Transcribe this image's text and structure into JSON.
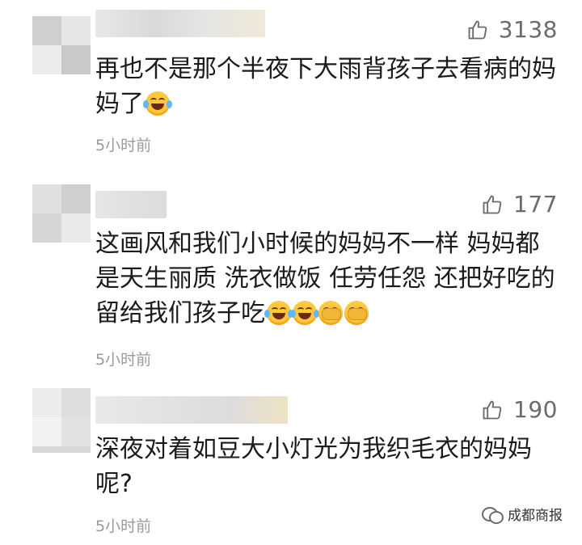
{
  "comments": [
    {
      "likes": "3138",
      "text": "再也不是那个半夜下大雨背孩子去看病的妈妈了",
      "emojis": [
        "laugh-cry-emoji"
      ],
      "time": "5小时前"
    },
    {
      "likes": "177",
      "text": "这画风和我们小时候的妈妈不一样 妈妈都是天生丽质 洗衣做饭 任劳任怨 还把好吃的留给我们孩子吃",
      "emojis": [
        "laugh-cry-emoji",
        "laugh-cry-emoji",
        "facepalm-emoji",
        "facepalm-emoji"
      ],
      "time": "5小时前"
    },
    {
      "likes": "190",
      "text": "深夜对着如豆大小灯光为我织毛衣的妈妈呢?",
      "emojis": [],
      "time": "5小时前"
    }
  ],
  "watermark": {
    "text": "成都商报",
    "icon": "wechat-icon"
  },
  "colors": {
    "text": "#1b1b1b",
    "meta": "#9a9a9a",
    "likes": "#6b6b6b",
    "emoji": "#ffc83a"
  }
}
